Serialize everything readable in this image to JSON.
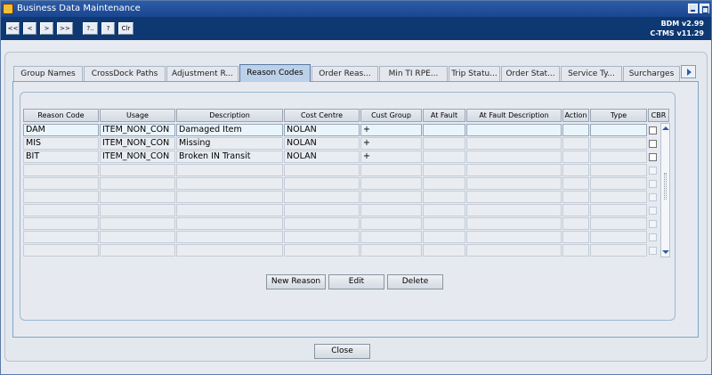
{
  "window": {
    "title": "Business Data Maintenance"
  },
  "toolbar": {
    "buttons": [
      "<<",
      "<",
      ">",
      ">>",
      "?..",
      "?",
      "Clr"
    ],
    "version1": "BDM v2.99",
    "version2": "C-TMS v11.29"
  },
  "tabs": [
    "Group Names",
    "CrossDock Paths",
    "Adjustment R...",
    "Reason Codes",
    "Order Reas...",
    "Min TI RPE...",
    "Trip Statu...",
    "Order Stat...",
    "Service Ty...",
    "Surcharges"
  ],
  "active_tab": "Reason Codes",
  "table": {
    "headers": [
      "Reason Code",
      "Usage",
      "Description",
      "Cost Centre",
      "Cust Group",
      "At Fault",
      "At Fault Description",
      "Action",
      "Type",
      "CBR"
    ],
    "rows": [
      [
        "DAM",
        "ITEM_NON_CON",
        "Damaged Item",
        "NOLAN",
        "+",
        "",
        "",
        "",
        "",
        ""
      ],
      [
        "MIS",
        "ITEM_NON_CON",
        "Missing",
        "NOLAN",
        "+",
        "",
        "",
        "",
        "",
        ""
      ],
      [
        "BIT",
        "ITEM_NON_CON",
        "Broken IN Transit",
        "NOLAN",
        "+",
        "",
        "",
        "",
        "",
        ""
      ]
    ]
  },
  "buttons": {
    "new_reason": "New Reason",
    "edit": "Edit",
    "delete": "Delete",
    "close": "Close"
  },
  "colors": {
    "titlebar": "#1a4590",
    "toolbar": "#0d3872",
    "active_tab": "#bcd0e8"
  },
  "icons": {
    "window_icon": "app-icon",
    "minimize": "minimize-icon",
    "maximize": "maximize-icon"
  }
}
